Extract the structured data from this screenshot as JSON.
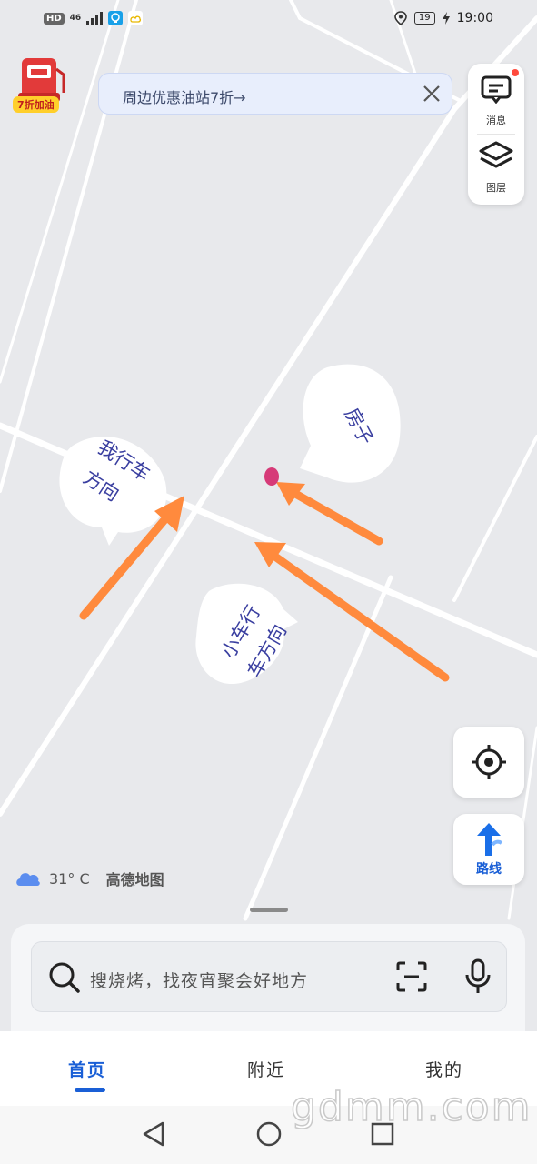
{
  "status_bar": {
    "network_chip": "HD",
    "network_type": "46",
    "battery": "19",
    "time": "19:00"
  },
  "promo": {
    "badge": "7折加油",
    "banner_text": "周边优惠油站7折→"
  },
  "side_panel": {
    "message_label": "消息",
    "layers_label": "图层"
  },
  "annotations": {
    "house": "房子",
    "my_direction": [
      "我行车",
      "方向"
    ],
    "car_direction": [
      "小车行",
      "车方向"
    ]
  },
  "weather": {
    "temperature": "31°  C",
    "brand": "高德地图"
  },
  "route_button": {
    "label": "路线"
  },
  "search": {
    "placeholder": "搜烧烤，找夜宵聚会好地方"
  },
  "tabs": [
    {
      "label": "首页"
    },
    {
      "label": "附近"
    },
    {
      "label": "我的"
    }
  ],
  "watermark": "gdmm.com",
  "colors": {
    "accent": "#1a5fd6",
    "arrow": "#ff8a3d",
    "marker": "#d63a78"
  }
}
